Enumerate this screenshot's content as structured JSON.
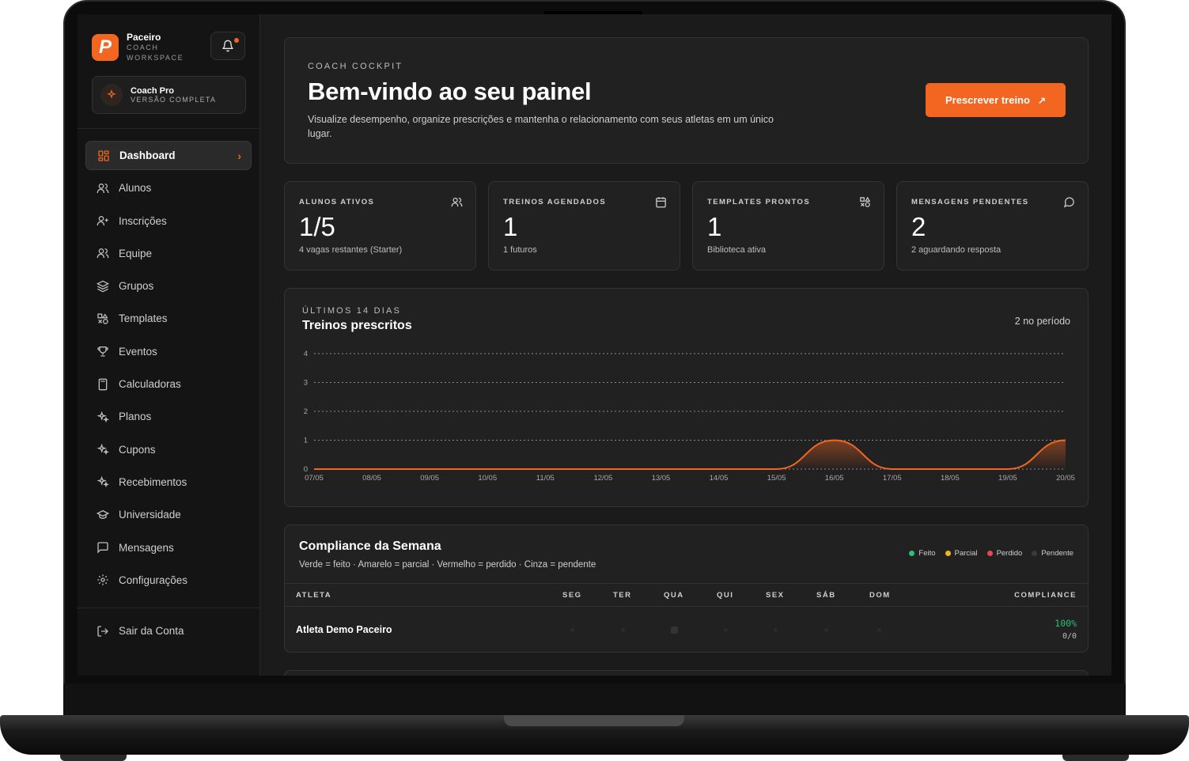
{
  "brand": {
    "name": "Paceiro",
    "sub1": "COACH",
    "sub2": "WORKSPACE",
    "logo_letter": "P"
  },
  "plan": {
    "name": "Coach Pro",
    "sub": "VERSÃO COMPLETA"
  },
  "nav": {
    "items": [
      {
        "label": "Dashboard",
        "icon": "grid-icon",
        "active": true
      },
      {
        "label": "Alunos",
        "icon": "users-icon"
      },
      {
        "label": "Inscrições",
        "icon": "user-plus-icon"
      },
      {
        "label": "Equipe",
        "icon": "team-icon"
      },
      {
        "label": "Grupos",
        "icon": "layers-icon"
      },
      {
        "label": "Templates",
        "icon": "shapes-icon"
      },
      {
        "label": "Eventos",
        "icon": "trophy-icon"
      },
      {
        "label": "Calculadoras",
        "icon": "calculator-icon"
      },
      {
        "label": "Planos",
        "icon": "sparkles-icon"
      },
      {
        "label": "Cupons",
        "icon": "sparkles-icon"
      },
      {
        "label": "Recebimentos",
        "icon": "sparkles-icon"
      },
      {
        "label": "Universidade",
        "icon": "graduation-cap-icon"
      },
      {
        "label": "Mensagens",
        "icon": "message-square-icon"
      },
      {
        "label": "Configurações",
        "icon": "settings-icon"
      }
    ],
    "logout": "Sair da Conta"
  },
  "hero": {
    "eyebrow": "COACH COCKPIT",
    "title": "Bem-vindo ao seu painel",
    "description": "Visualize desempenho, organize prescrições e mantenha o relacionamento com seus atletas em um único lugar.",
    "cta": "Prescrever treino",
    "cta_icon": "arrow-up-right-icon"
  },
  "stats": [
    {
      "label": "ALUNOS ATIVOS",
      "value": "1/5",
      "hint": "4 vagas restantes (Starter)",
      "icon": "users-icon"
    },
    {
      "label": "TREINOS AGENDADOS",
      "value": "1",
      "hint": "1 futuros",
      "icon": "calendar-icon"
    },
    {
      "label": "TEMPLATES PRONTOS",
      "value": "1",
      "hint": "Biblioteca ativa",
      "icon": "shapes-icon"
    },
    {
      "label": "MENSAGENS PENDENTES",
      "value": "2",
      "hint": "2 aguardando resposta",
      "icon": "message-circle-icon"
    }
  ],
  "chart": {
    "eyebrow": "ÚLTIMOS 14 DIAS",
    "title": "Treinos prescritos",
    "period": "2 no período"
  },
  "chart_data": {
    "type": "area",
    "title": "Treinos prescritos",
    "x": [
      "07/05",
      "08/05",
      "09/05",
      "10/05",
      "11/05",
      "12/05",
      "13/05",
      "14/05",
      "15/05",
      "16/05",
      "17/05",
      "18/05",
      "19/05",
      "20/05"
    ],
    "series": [
      {
        "values": [
          0,
          0,
          0,
          0,
          0,
          0,
          0,
          0,
          0,
          1,
          0,
          0,
          0,
          1
        ]
      }
    ],
    "ylim": [
      0,
      4
    ],
    "yticks": [
      "0",
      "1",
      "2",
      "3",
      "4"
    ],
    "grid": true,
    "color": "#f26622"
  },
  "compliance": {
    "title": "Compliance da Semana",
    "subtitle": "Verde = feito · Amarelo = parcial · Vermelho = perdido · Cinza = pendente",
    "legend": [
      {
        "label": "Feito",
        "color": "#2fbf71"
      },
      {
        "label": "Parcial",
        "color": "#f2b322"
      },
      {
        "label": "Perdido",
        "color": "#e5484d"
      },
      {
        "label": "Pendente",
        "color": "#3a3a3a"
      }
    ],
    "columns": [
      "ATLETA",
      "SEG",
      "TER",
      "QUA",
      "QUI",
      "SEX",
      "SÁB",
      "DOM",
      "COMPLIANCE"
    ],
    "rows": [
      {
        "athlete": "Atleta Demo Paceiro",
        "compliance": "100%",
        "ratio": "0/0"
      }
    ]
  }
}
